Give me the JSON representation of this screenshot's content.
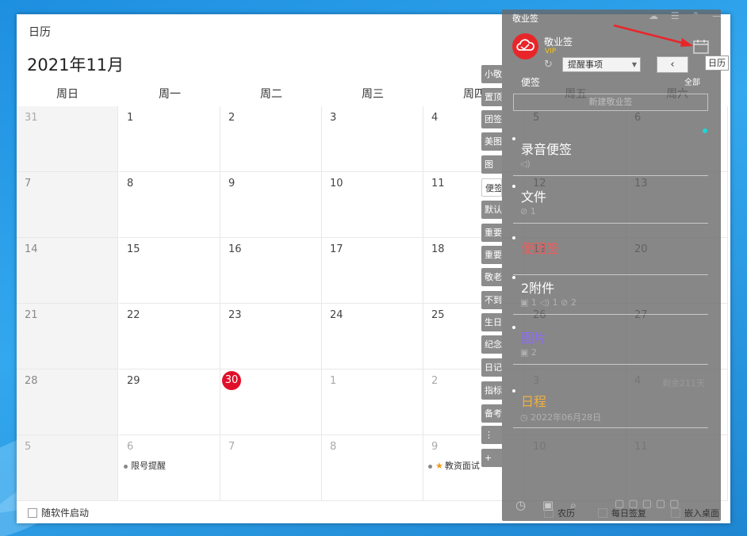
{
  "calendar": {
    "title": "日历",
    "month_label": "2021年11月",
    "weekdays": [
      "周日",
      "周一",
      "周二",
      "周三",
      "周四",
      "周五",
      "周六"
    ],
    "rows": [
      [
        "31",
        "1",
        "2",
        "3",
        "4",
        "5",
        "6"
      ],
      [
        "7",
        "8",
        "9",
        "10",
        "11",
        "12",
        "13"
      ],
      [
        "14",
        "15",
        "16",
        "17",
        "18",
        "19",
        "20"
      ],
      [
        "21",
        "22",
        "23",
        "24",
        "25",
        "26",
        "27"
      ],
      [
        "28",
        "29",
        "30",
        "1",
        "2",
        "3",
        "4"
      ],
      [
        "5",
        "6",
        "7",
        "8",
        "9",
        "10",
        "11"
      ]
    ],
    "today": "30",
    "events": {
      "mon_6": "限号提醒",
      "thu_9": "教资面试"
    },
    "remaining_days": "剩余211天",
    "autostart_label": "随软件启动",
    "tooltip": "日历"
  },
  "side_tabs": [
    "小敬",
    "置顶",
    "团签",
    "美图",
    "图",
    "便签",
    "默认",
    "重要",
    "重要",
    "敬老",
    "不到",
    "生日",
    "纪念",
    "日记",
    "指标",
    "备考",
    "⋮",
    "+"
  ],
  "panel": {
    "app_title": "敬业签",
    "account_name": "敬业签",
    "vip_badge": "VIP",
    "category_select": "提醒事项",
    "section_label": "便签",
    "filter_label": "全部",
    "new_note_placeholder": "新建敬业签",
    "notes": [
      {
        "title": "录音便签",
        "meta": "◁)",
        "color": "#ffffff"
      },
      {
        "title": "文件",
        "meta": "⊘ 1",
        "color": "#ffffff"
      },
      {
        "title": "便团签",
        "meta": "",
        "color": "#f05a5a"
      },
      {
        "title": "2附件",
        "meta": "▣ 1  ◁) 1  ⊘ 2",
        "color": "#ffffff"
      },
      {
        "title": "图片",
        "meta": "▣ 2",
        "color": "#8a6cf0"
      },
      {
        "title": "日程",
        "meta": "◷ 2022年06月28日",
        "color": "#f0b040"
      }
    ],
    "footer_checks": [
      "农历",
      "每日签复",
      "嵌入桌面"
    ]
  },
  "colors": {
    "accent_red": "#e0102a",
    "brand_red": "#e8262a",
    "teal_dot": "#1fd6d6"
  }
}
